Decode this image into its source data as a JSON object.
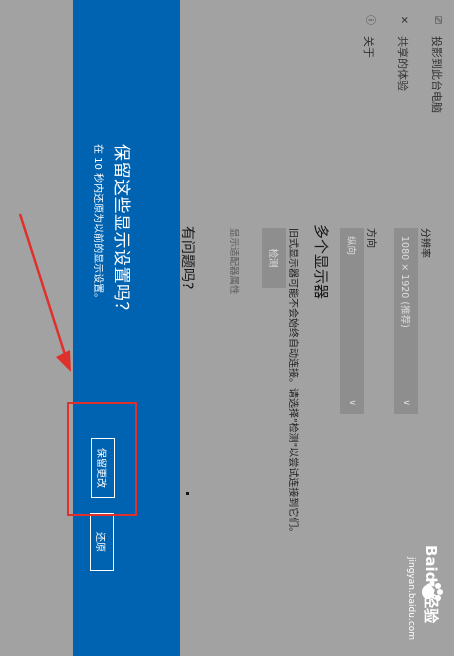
{
  "nav": {
    "items": [
      {
        "icon": "project-icon",
        "glyph": "⎚",
        "label": "投影到此台电脑"
      },
      {
        "icon": "shared-icon",
        "glyph": "✕",
        "label": "共享的体验"
      },
      {
        "icon": "info-icon",
        "glyph": "ⓘ",
        "label": "关于"
      }
    ]
  },
  "display": {
    "resolution_label": "分辨率",
    "resolution_value": "1080 × 1920 (推荐)",
    "orientation_label": "方向",
    "orientation_value": "纵向",
    "multi_display_heading": "多个显示器",
    "multi_display_desc": "旧式显示器可能不会始终自动连接。请选择\"检测\"以尝试连接到它们。",
    "detect_button": "检测",
    "adapter_link": "显示适配器属性",
    "question_heading": "有问题吗?"
  },
  "dialog": {
    "title": "保留这些显示设置吗？",
    "subtitle": "在 10 秒内还原为以前的显示设置。",
    "keep_button": "保留更改",
    "revert_button": "还原"
  },
  "watermark": {
    "brand": "Baidu经验",
    "url": "jingyan.baidu.com"
  },
  "colors": {
    "dialog_blue": "#0063b1",
    "highlight_red": "#e0302c",
    "overlay_gray": "#a2a2a2"
  }
}
